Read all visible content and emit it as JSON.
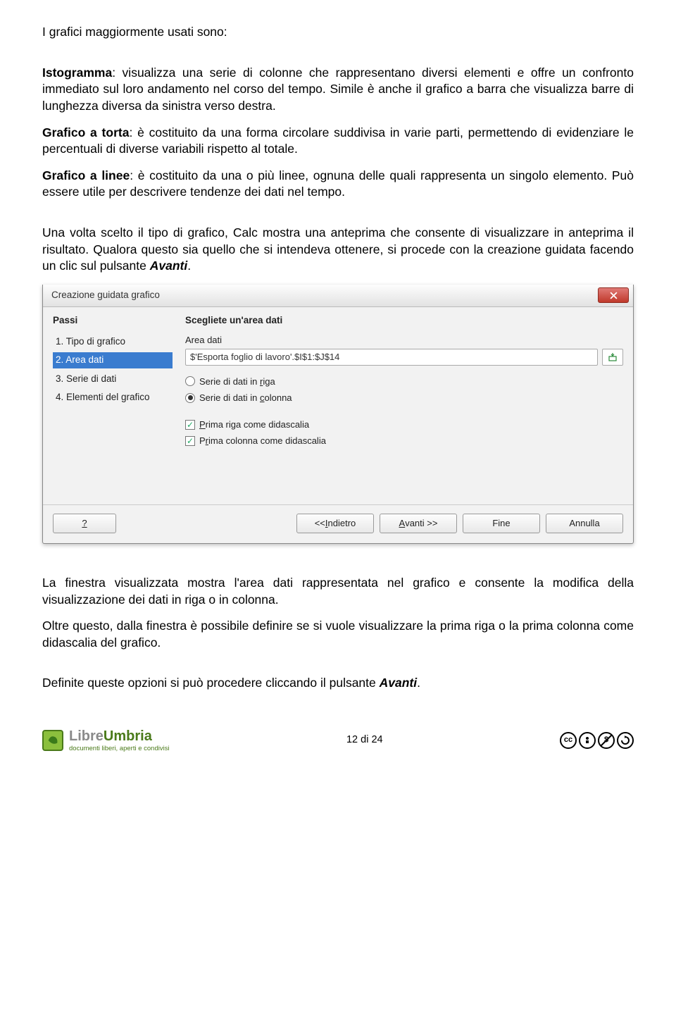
{
  "text": {
    "intro": "I grafici maggiormente usati sono:",
    "isto_label": "Istogramma",
    "isto_body": ": visualizza una serie di colonne che rappresentano diversi elementi e offre un confronto immediato sul loro andamento nel corso del tempo. Simile è anche il grafico a barra che visualizza barre di lunghezza diversa da sinistra verso destra.",
    "torta_label": "Grafico a torta",
    "torta_body": ": è costituito da una forma circolare suddivisa in varie parti, permettendo di evidenziare le percentuali di diverse variabili rispetto al totale.",
    "linee_label": "Grafico a linee",
    "linee_body": ": è costituito da una o più linee, ognuna delle quali rappresenta un singolo elemento. Può essere utile per descrivere tendenze dei dati nel tempo.",
    "para2_a": "Una volta scelto il tipo di grafico, Calc mostra una anteprima che consente di visualizzare in anteprima il risultato. Qualora questo sia quello che si intendeva ottenere, si procede con la creazione guidata facendo un clic sul pulsante ",
    "para2_b": "Avanti",
    "para2_c": ".",
    "para3": "La finestra visualizzata mostra l'area dati rappresentata nel grafico e consente la modifica della visualizzazione dei dati in riga o in colonna.",
    "para4": "Oltre questo, dalla finestra è possibile definire se si vuole visualizzare la prima riga o la prima colonna come didascalia del grafico.",
    "para5_a": "Definite queste opzioni si può procedere cliccando il pulsante ",
    "para5_b": "Avanti",
    "para5_c": "."
  },
  "dialog": {
    "title": "Creazione guidata grafico",
    "steps_title": "Passi",
    "steps": {
      "s1": "1. Tipo di grafico",
      "s2": "2. Area dati",
      "s3": "3. Serie di dati",
      "s4": "4. Elementi del grafico"
    },
    "main_title": "Scegliete un'area dati",
    "area_label": "Area dati",
    "area_value": "$'Esporta foglio di lavoro'.$I$1:$J$14",
    "radio_riga": "Serie di dati in riga",
    "radio_colonna": "Serie di dati in colonna",
    "chk_prima_riga": "Prima riga come didascalia",
    "chk_prima_col": "Prima colonna come didascalia",
    "btn_help": "?",
    "btn_indietro": "<< Indietro",
    "btn_avanti": "Avanti >>",
    "btn_fine": "Fine",
    "btn_annulla": "Annulla"
  },
  "footer": {
    "logo_main_a": "Libre",
    "logo_main_b": "Umbria",
    "logo_sub": "documenti liberi, aperti e condivisi",
    "page_num": "12 di 24",
    "cc": {
      "a": "cc",
      "b": "BY",
      "c": "$",
      "d": "SA"
    }
  }
}
